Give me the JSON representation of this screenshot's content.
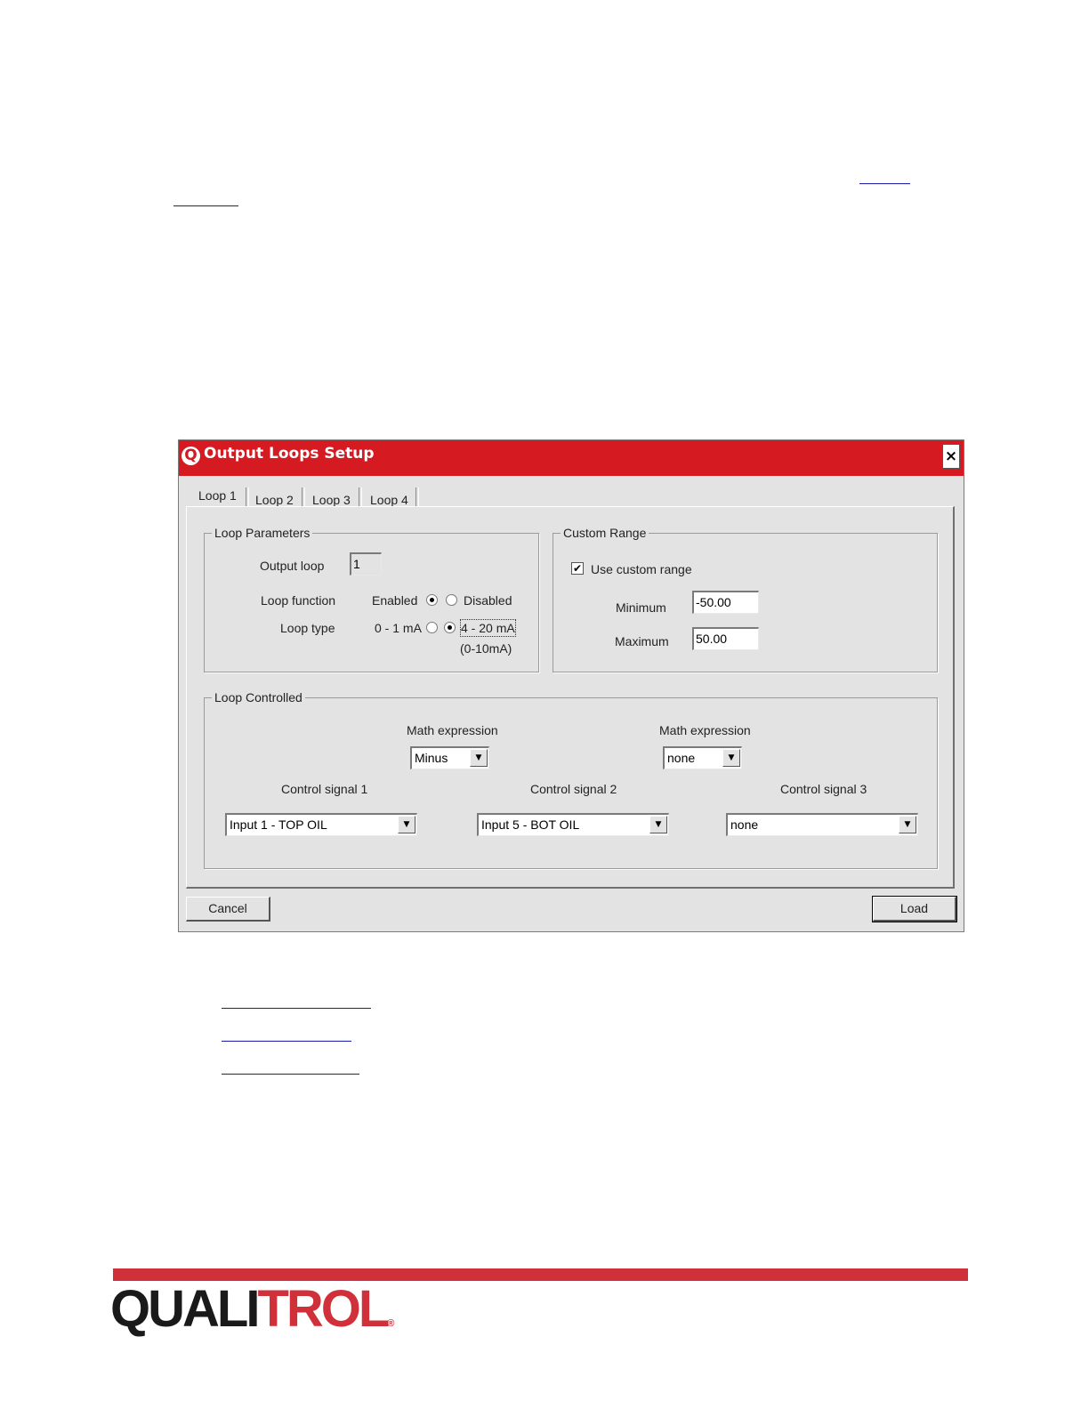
{
  "window": {
    "title": "Output Loops Setup",
    "app_icon": "Q",
    "close_glyph": "×",
    "colors": {
      "titlebar": "#d61a21",
      "face": "#e3e3e3"
    }
  },
  "tabs": [
    {
      "label": "Loop 1",
      "selected": true
    },
    {
      "label": "Loop 2",
      "selected": false
    },
    {
      "label": "Loop 3",
      "selected": false
    },
    {
      "label": "Loop 4",
      "selected": false
    }
  ],
  "loop_parameters": {
    "legend": "Loop Parameters",
    "output_loop_label": "Output loop",
    "output_loop_value": "1",
    "loop_function_label": "Loop function",
    "enabled_label": "Enabled",
    "disabled_label": "Disabled",
    "loop_function_selected": "Enabled",
    "loop_type_label": "Loop type",
    "type_0_1_label": "0 - 1 mA",
    "type_4_20_label": "4 - 20 mA",
    "type_4_20_note": "(0-10mA)",
    "loop_type_selected": "4 - 20 mA"
  },
  "custom_range": {
    "legend": "Custom Range",
    "use_custom_label": "Use custom range",
    "use_custom_checked": true,
    "check_glyph": "✔",
    "minimum_label": "Minimum",
    "minimum_value": "-50.00",
    "maximum_label": "Maximum",
    "maximum_value": "50.00"
  },
  "loop_controlled": {
    "legend": "Loop Controlled",
    "math1_label": "Math expression",
    "math1_value": "Minus",
    "math2_label": "Math expression",
    "math2_value": "none",
    "signal1_label": "Control signal 1",
    "signal1_value": "Input 1 - TOP OIL",
    "signal2_label": "Control signal 2",
    "signal2_value": "Input 5 - BOT OIL",
    "signal3_label": "Control signal 3",
    "signal3_value": "none",
    "arrow_glyph": "▼"
  },
  "buttons": {
    "cancel": "Cancel",
    "load": "Load"
  },
  "footer": {
    "logo_dark": "QUALI",
    "logo_red": "TROL",
    "logo_reg": "®",
    "colors": {
      "bar": "#d03039",
      "logo_dark": "#1a1a1a"
    }
  }
}
